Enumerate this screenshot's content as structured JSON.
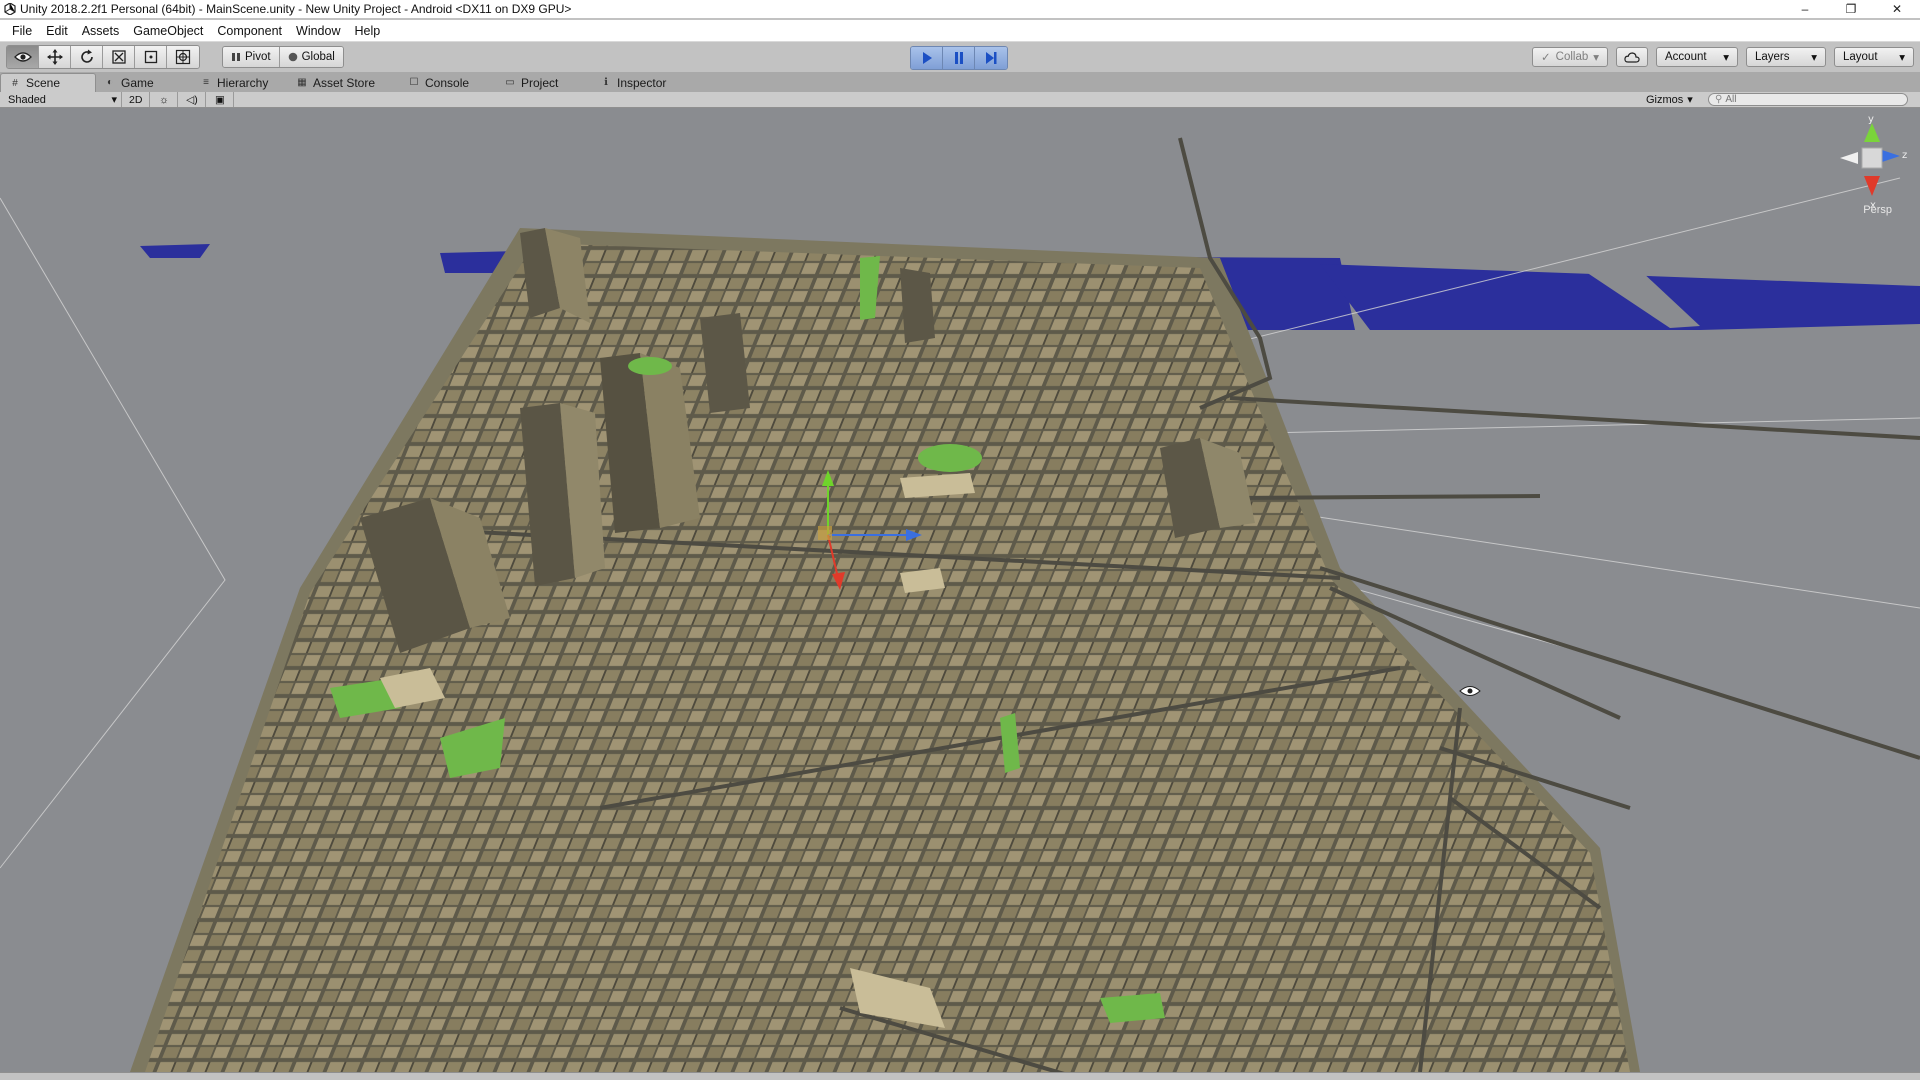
{
  "window": {
    "title": "Unity 2018.2.2f1 Personal (64bit) - MainScene.unity - New Unity Project - Android <DX11 on DX9 GPU>",
    "minimize": "–",
    "restore": "❐",
    "close": "✕"
  },
  "menubar": {
    "items": [
      "File",
      "Edit",
      "Assets",
      "GameObject",
      "Component",
      "Window",
      "Help"
    ]
  },
  "toolbar": {
    "pivot_label": "Pivot",
    "global_label": "Global",
    "collab_label": "Collab",
    "account_label": "Account",
    "layers_label": "Layers",
    "layout_label": "Layout",
    "dropdown_arrow": "▾"
  },
  "tabs": [
    {
      "label": "Scene",
      "icon": "scene-icon"
    },
    {
      "label": "Game",
      "icon": "game-icon"
    },
    {
      "label": "Hierarchy",
      "icon": "hierarchy-icon"
    },
    {
      "label": "Asset Store",
      "icon": "asset-store-icon"
    },
    {
      "label": "Console",
      "icon": "console-icon"
    },
    {
      "label": "Project",
      "icon": "project-icon"
    },
    {
      "label": "Inspector",
      "icon": "inspector-icon"
    }
  ],
  "scene_toolbar": {
    "shading_mode": "Shaded",
    "mode_2d": "2D",
    "gizmos_label": "Gizmos",
    "search_placeholder": "All"
  },
  "scene_gizmo": {
    "projection_label": "Persp",
    "axis_y": "y",
    "axis_z": "z",
    "axis_x": "x"
  },
  "colors": {
    "play_active": "#7f9fd6",
    "water": "#2b2f9c",
    "buildings": "#8b8163",
    "parks": "#6fb84a",
    "background": "#8a8c90"
  }
}
